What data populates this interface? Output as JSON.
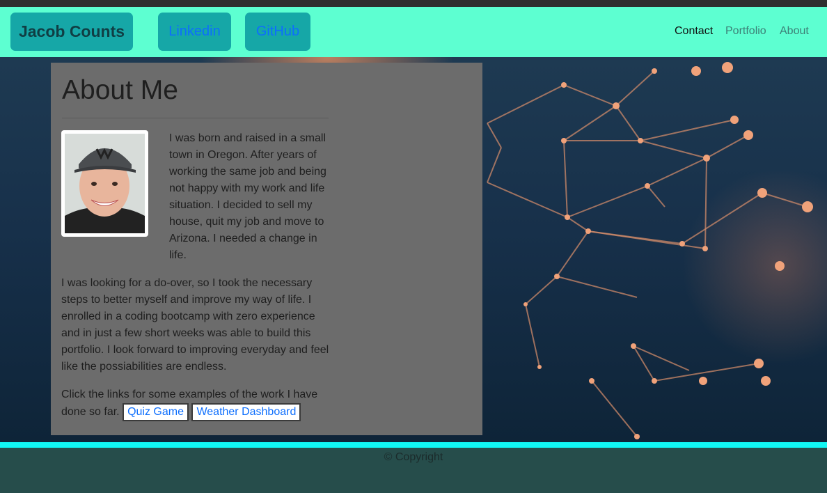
{
  "navbar": {
    "brand": "Jacob Counts",
    "linkedin": "Linkedin",
    "github": "GitHub",
    "links": [
      "Contact",
      "Portfolio",
      "About"
    ]
  },
  "about": {
    "title": "About Me",
    "para1": "I was born and raised in a small town in Oregon. After years of working the same job and being not happy with my work and life situation. I decided to sell my house, quit my job and move to Arizona. I needed a change in life.",
    "para2": "I was looking for a do-over, so I took the necessary steps to better myself and improve my way of life. I enrolled in a coding bootcamp with zero experience and in just a few short weeks was able to build this portfolio. I look forward to improving everyday and feel like the possiabilities are endless.",
    "para3": "Click the links for some examples of the work I have done so far.",
    "buttons": [
      "Quiz Game",
      "Weather Dashboard"
    ]
  },
  "footer": {
    "text": "© Copyright"
  },
  "colors": {
    "navbar": "#5dffd1",
    "nav_button": "#16a7a7",
    "card": "#6c6c6c",
    "footer_line": "#11f7f4",
    "footer": "#264d4b",
    "link": "#0d6efd"
  }
}
